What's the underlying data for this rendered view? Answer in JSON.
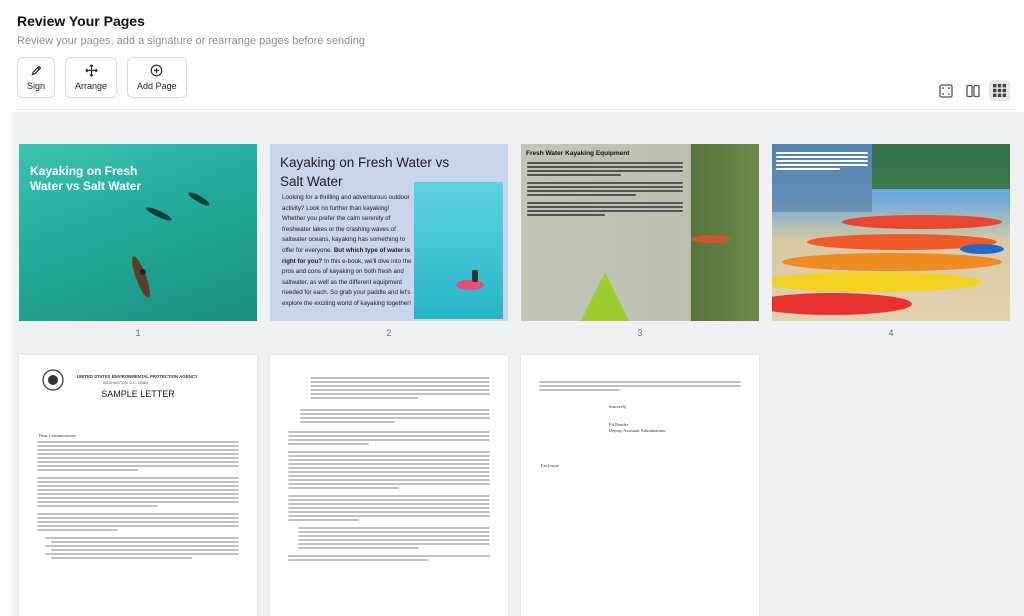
{
  "header": {
    "title": "Review Your Pages",
    "subtitle": "Review your pages, add a signature or rearrange pages before sending"
  },
  "toolbar": {
    "sign_label": "Sign",
    "arrange_label": "Arrange",
    "add_page_label": "Add Page"
  },
  "view_modes": [
    "fit-view-icon",
    "two-column-icon",
    "grid-view-icon"
  ],
  "active_view": "grid",
  "pages": [
    {
      "number": "1",
      "heading": "Kayaking on Fresh Water vs Salt Water"
    },
    {
      "number": "2",
      "title": "Kayaking on Fresh Water vs Salt Water",
      "body": "Looking for a thrilling and adventurous outdoor activity? Look no further than kayaking! Whether you prefer the calm serenity of freshwater lakes or the crashing waves of saltwater oceans, kayaking has something to offer for everyone.",
      "bold": "But which type of water is right for you?",
      "body2": "In this e-book, we'll dive into the pros and cons of kayaking on both fresh and saltwater, as well as the different equipment needed for each. So grab your paddle and let's explore the exciting world of kayaking together!"
    },
    {
      "number": "3",
      "title": "Fresh Water Kayaking Equipment"
    },
    {
      "number": "4"
    }
  ],
  "docs": [
    {
      "agency": "UNITED STATES ENVIRONMENTAL PROTECTION AGENCY",
      "city": "WASHINGTON, D.C. 20460",
      "title": "SAMPLE LETTER",
      "salutation": "Dear Commissioner:"
    },
    {},
    {
      "signer": "Sincerely,",
      "name": "Ed Bender",
      "role": "Deputy Assistant Administrator",
      "enclosure": "Enclosure"
    }
  ],
  "colors": {
    "accent": "#1f2328",
    "grid_bg": "#eef0f2"
  }
}
